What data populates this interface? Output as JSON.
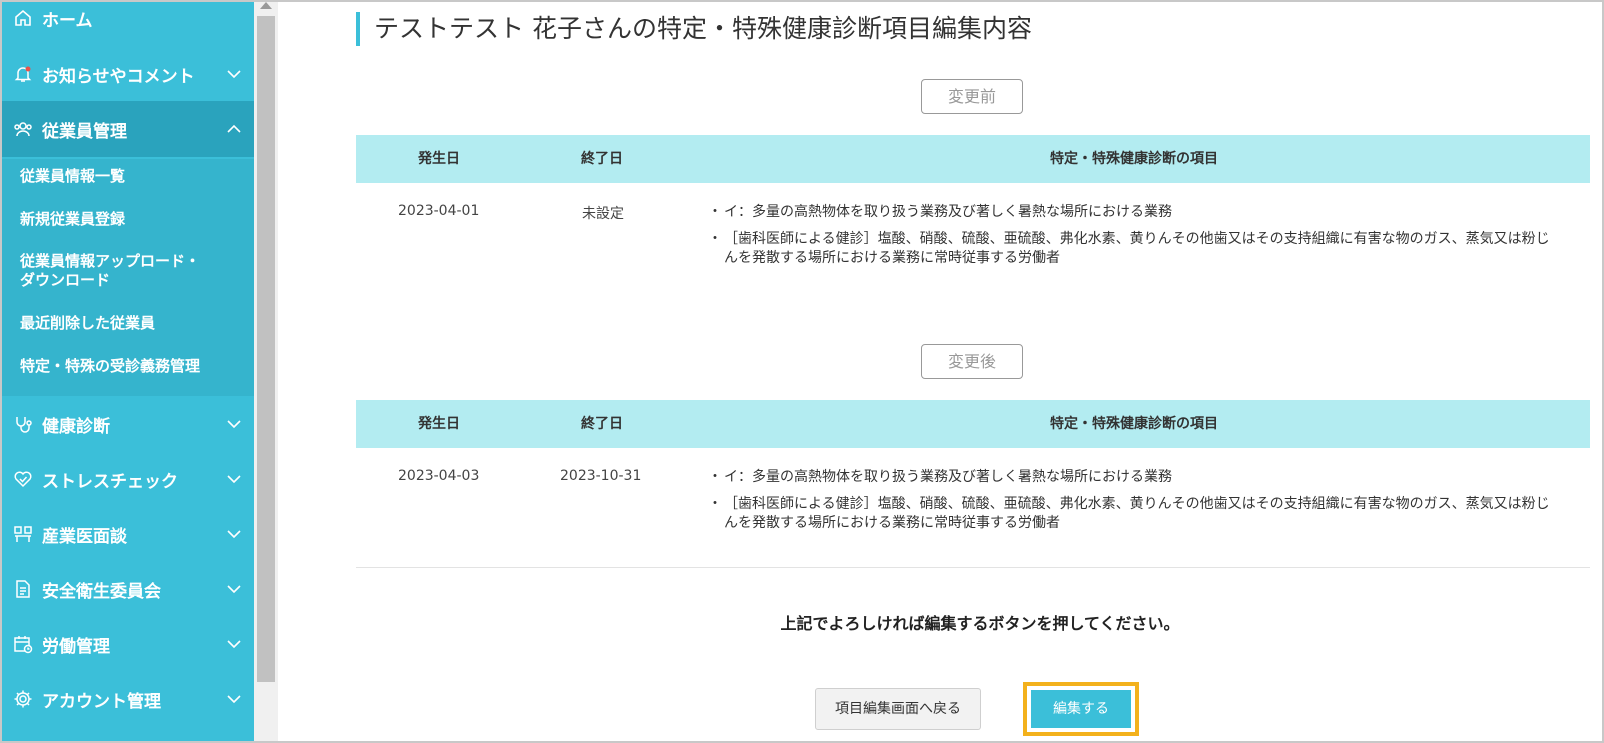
{
  "sidebar": {
    "home": {
      "label": "ホーム"
    },
    "items": [
      {
        "label": "お知らせやコメント"
      },
      {
        "label": "従業員管理"
      },
      {
        "label": "健康診断"
      },
      {
        "label": "ストレスチェック"
      },
      {
        "label": "産業医面談"
      },
      {
        "label": "安全衛生委員会"
      },
      {
        "label": "労働管理"
      },
      {
        "label": "アカウント管理"
      }
    ],
    "submenu": [
      {
        "label": "従業員情報一覧"
      },
      {
        "label": "新規従業員登録"
      },
      {
        "label": "従業員情報アップロード・"
      },
      {
        "label": "ダウンロード"
      },
      {
        "label": "最近削除した従業員"
      },
      {
        "label": "特定・特殊の受診義務管理"
      }
    ]
  },
  "page": {
    "title": "テストテスト 花子さんの特定・特殊健康診断項目編集内容"
  },
  "before": {
    "tag": "変更前",
    "headers": {
      "start": "発生日",
      "end": "終了日",
      "items": "特定・特殊健康診断の項目"
    },
    "row": {
      "start": "2023-04-01",
      "end": "未設定",
      "items": [
        "イ：多量の高熱物体を取り扱う業務及び著しく暑熱な場所における業務",
        "［歯科医師による健診］塩酸、硝酸、硫酸、亜硫酸、弗化水素、黄りんその他歯又はその支持組織に有害な物のガス、蒸気又は粉じんを発散する場所における業務に常時従事する労働者"
      ]
    }
  },
  "after": {
    "tag": "変更後",
    "headers": {
      "start": "発生日",
      "end": "終了日",
      "items": "特定・特殊健康診断の項目"
    },
    "row": {
      "start": "2023-04-03",
      "end": "2023-10-31",
      "items": [
        "イ：多量の高熱物体を取り扱う業務及び著しく暑熱な場所における業務",
        "［歯科医師による健診］塩酸、硝酸、硫酸、亜硫酸、弗化水素、黄りんその他歯又はその支持組織に有害な物のガス、蒸気又は粉じんを発散する場所における業務に常時従事する労働者"
      ]
    }
  },
  "confirm_text": "上記でよろしければ編集するボタンを押してください。",
  "buttons": {
    "back": "項目編集画面へ戻る",
    "edit": "編集する"
  },
  "colors": {
    "sidebar": "#3bbfd9",
    "table_header": "#b3ecf1",
    "focus_outline": "#f3b11c"
  }
}
